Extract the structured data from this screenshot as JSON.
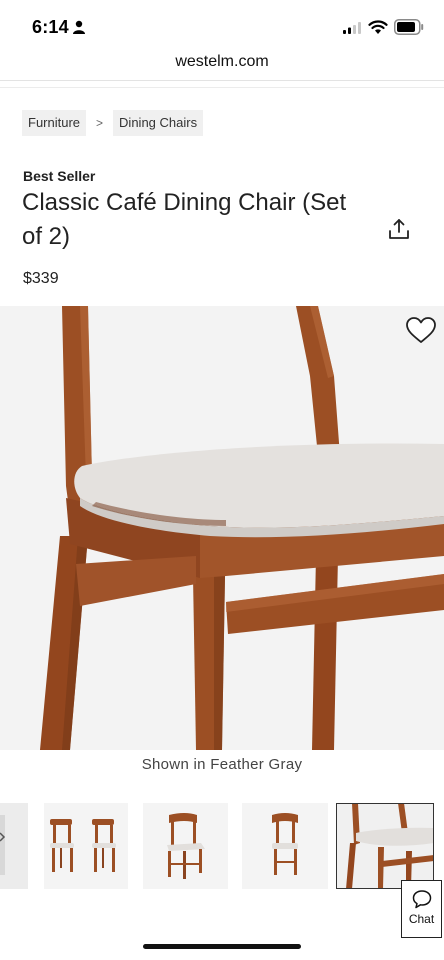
{
  "status_bar": {
    "time": "6:14",
    "icons": [
      "person-icon",
      "signal-icon",
      "wifi-icon",
      "battery-icon"
    ]
  },
  "browser": {
    "url": "westelm.com"
  },
  "breadcrumb": {
    "items": [
      "Furniture",
      "Dining Chairs"
    ],
    "separator": ">"
  },
  "product": {
    "badge": "Best Seller",
    "title": "Classic Café Dining Chair (Set of 2)",
    "price": "$339",
    "image_caption": "Shown in Feather Gray",
    "colors": {
      "wood": "#9c4f24",
      "wood_dark": "#7a3a18",
      "fabric": "#e4e1de",
      "background": "#f3f3f3"
    }
  },
  "thumbnails": {
    "count_visible": 5,
    "selected_index": 4
  },
  "chat": {
    "label": "Chat"
  }
}
